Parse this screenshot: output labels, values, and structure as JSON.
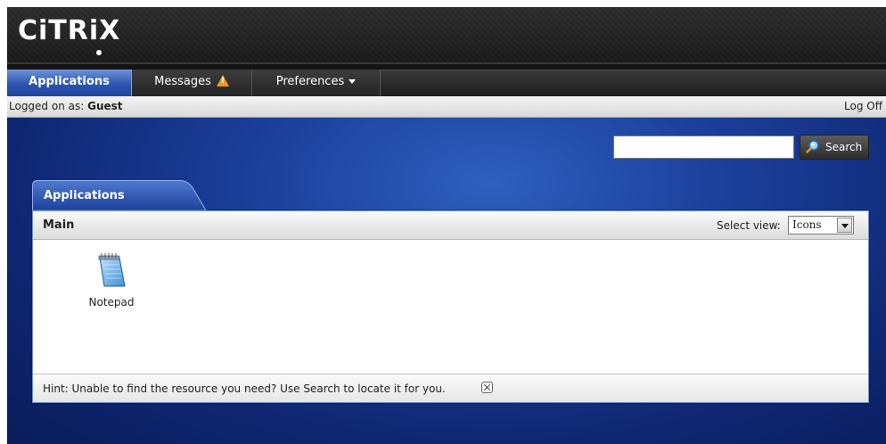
{
  "brand": {
    "logo_text": "CiTRiX"
  },
  "nav": {
    "tabs": [
      {
        "label": "Applications",
        "active": true
      },
      {
        "label": "Messages",
        "icon": "warning-icon"
      },
      {
        "label": "Preferences",
        "icon": "chevron-down-icon"
      }
    ]
  },
  "userbar": {
    "prefix": "Logged on as: ",
    "user": "Guest",
    "logoff": "Log Off"
  },
  "search": {
    "value": "",
    "button_label": "Search",
    "icon": "search-icon"
  },
  "panel": {
    "tab_label": "Applications",
    "section_title": "Main",
    "view_label": "Select view:",
    "view_selected": "Icons",
    "apps": [
      {
        "label": "Notepad",
        "icon": "notepad-icon"
      }
    ],
    "hint": "Hint: Unable to find the resource you need? Use Search to locate it for you."
  },
  "colors": {
    "accent": "#2c55b0",
    "background": "#0f2772",
    "warning": "#f39a13"
  }
}
